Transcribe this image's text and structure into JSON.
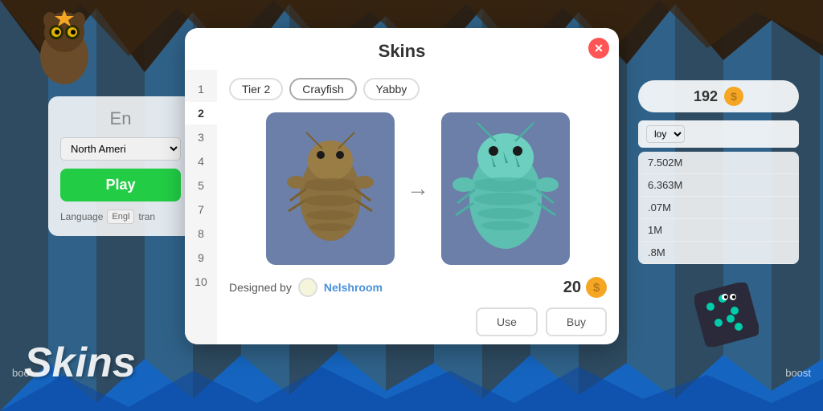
{
  "background": {
    "color": "#1a7fd4"
  },
  "modal": {
    "title": "Skins",
    "close_label": "✕",
    "tabs": [
      "Tier 2",
      "Crayfish",
      "Yabby"
    ],
    "numbers": [
      "1",
      "2",
      "3",
      "4",
      "5",
      "7",
      "8",
      "9",
      "10"
    ],
    "selected_number": "2",
    "skin_from": "brown crayfish",
    "skin_to": "teal crayfish",
    "arrow": "→",
    "designer_label": "Designed by",
    "designer_name": "Nelshroom",
    "price": "20",
    "use_button": "Use",
    "buy_button": "Buy"
  },
  "left_panel": {
    "title": "En",
    "region": "North Ameri",
    "play_button": "Play",
    "language_label": "Language",
    "language_value": "Engl",
    "language_sub": "tran"
  },
  "right_panel": {
    "coins": "192",
    "dropdown_value": "loy",
    "list_items": [
      "7.502M",
      "6.363M",
      ".07M",
      "1M",
      ".8M"
    ]
  },
  "watermark": {
    "skins_text": "Skins"
  },
  "boost_left": "boo",
  "boost_right": "boost"
}
